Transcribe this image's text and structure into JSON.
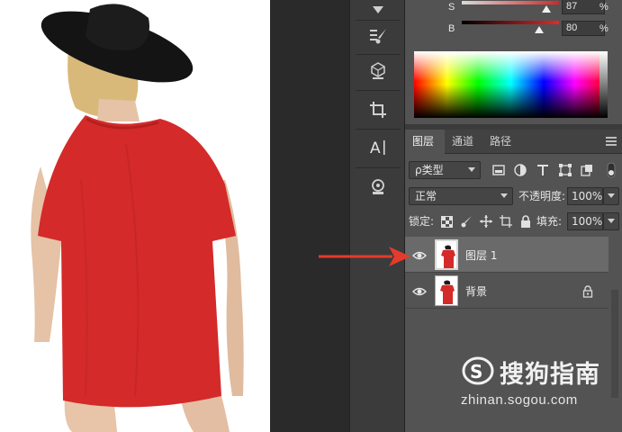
{
  "color_panel": {
    "sliders": [
      {
        "label": "S",
        "value": "87",
        "unit": "%",
        "level": 0.87
      },
      {
        "label": "B",
        "value": "80",
        "unit": "%",
        "level": 0.8
      }
    ]
  },
  "layers_panel": {
    "tabs": [
      "图层",
      "通道",
      "路径"
    ],
    "filter": {
      "label": "ρ类型"
    },
    "blend_mode": "正常",
    "opacity_label": "不透明度:",
    "opacity_value": "100%",
    "lock_label": "锁定:",
    "fill_label": "填充:",
    "fill_value": "100%",
    "layers": [
      {
        "name": "图层 1",
        "selected": true,
        "locked": false
      },
      {
        "name": "背景",
        "selected": false,
        "locked": true
      }
    ]
  },
  "watermark": {
    "logo_text": "搜狗指南",
    "url": "zhinan.sogou.com"
  },
  "colors": {
    "shirt": "#d42a2a",
    "panel_bg": "#535353",
    "arrow": "#e53b2c"
  }
}
